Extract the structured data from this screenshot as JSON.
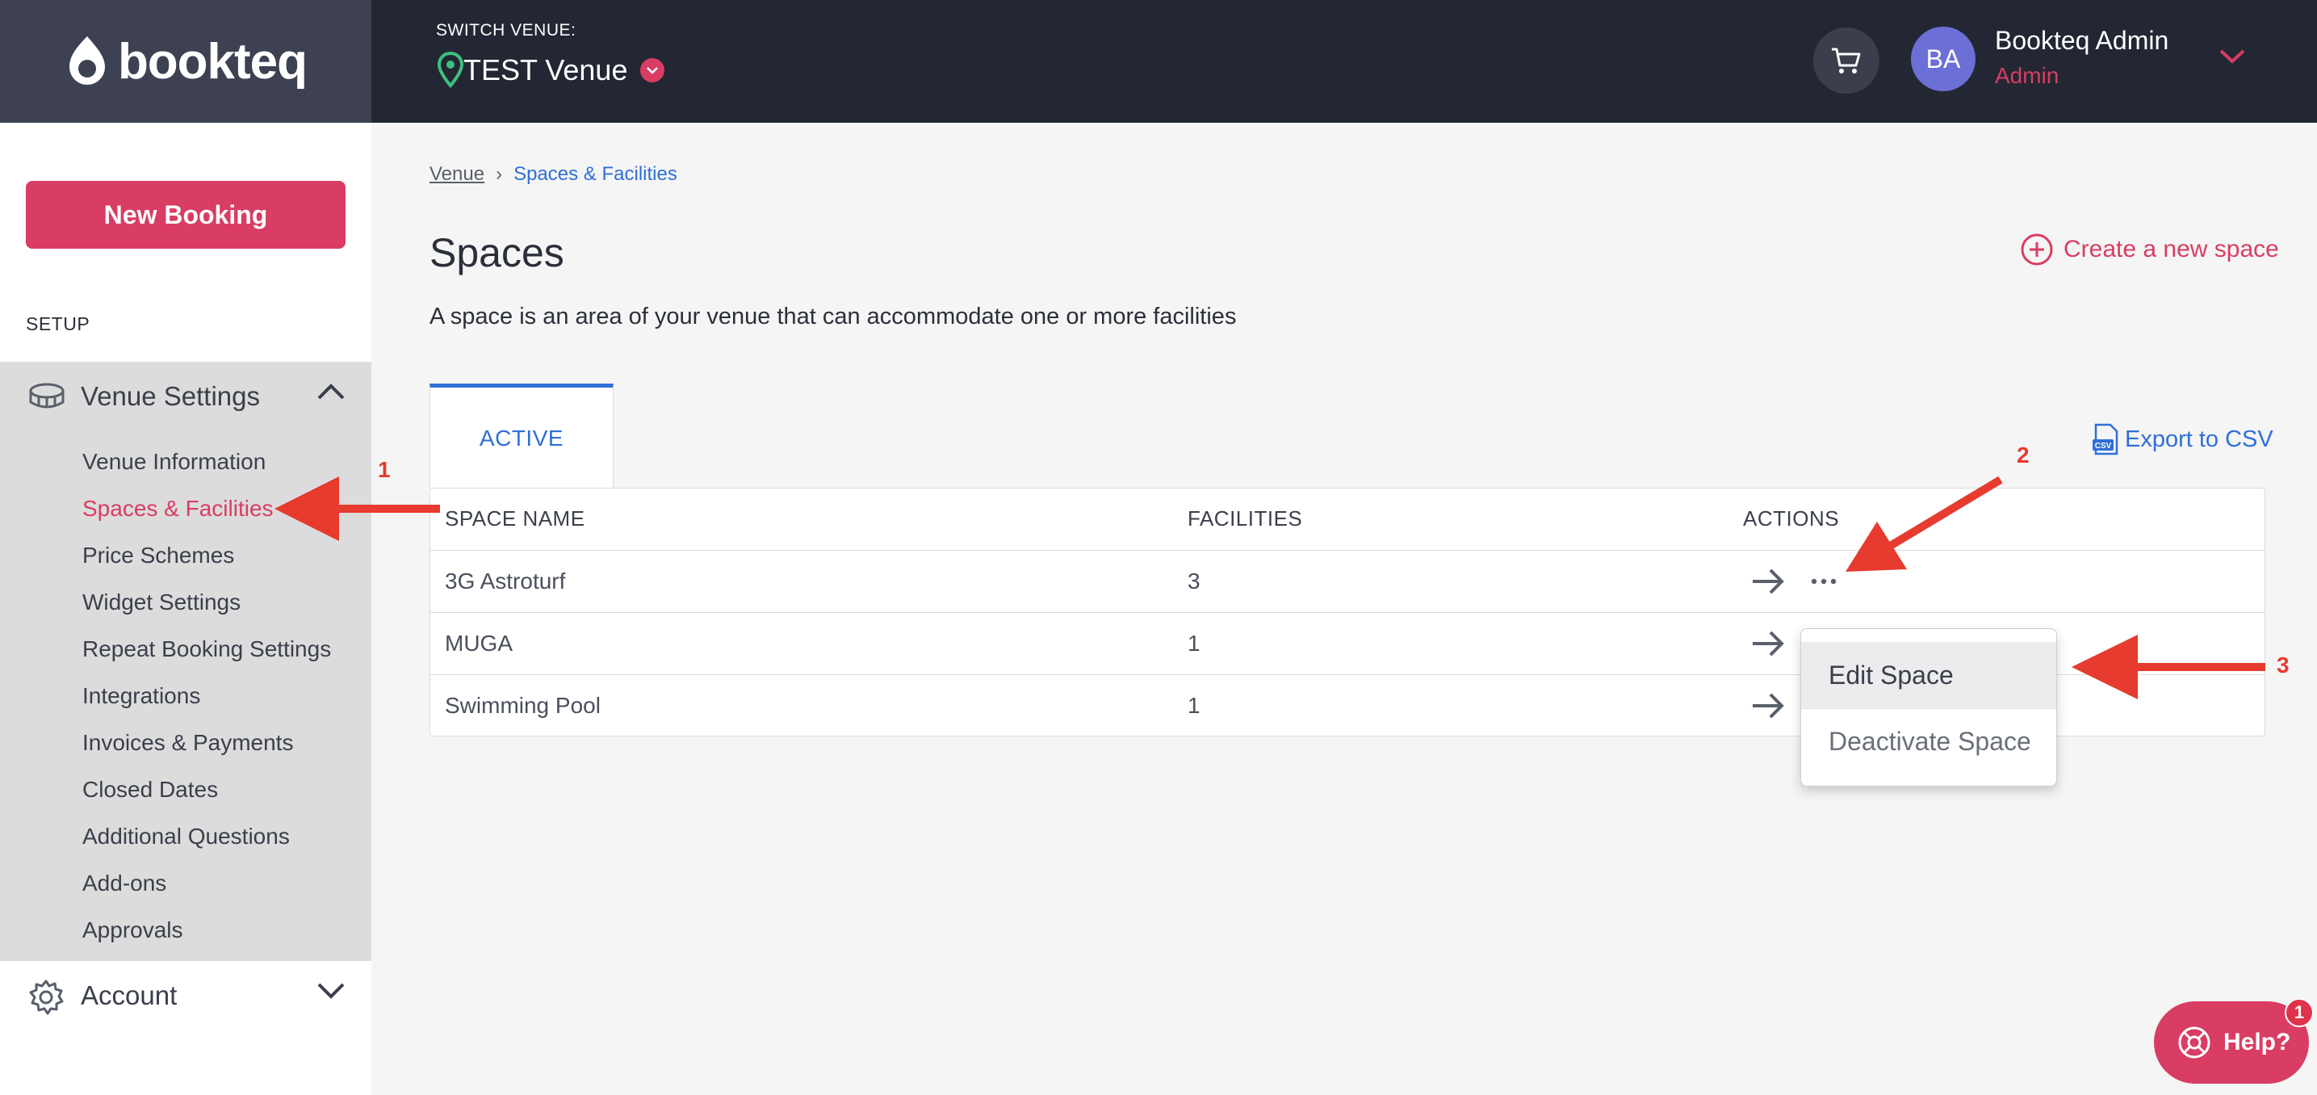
{
  "app": {
    "logo": "bookteq"
  },
  "header": {
    "switch_label": "SWITCH VENUE:",
    "venue_name": "TEST Venue",
    "user_initials": "BA",
    "user_name": "Bookteq Admin",
    "user_role": "Admin"
  },
  "sidebar": {
    "new_booking": "New Booking",
    "setup_label": "SETUP",
    "venue_settings": {
      "title": "Venue Settings",
      "items": [
        {
          "label": "Venue Information",
          "active": false
        },
        {
          "label": "Spaces & Facilities",
          "active": true
        },
        {
          "label": "Price Schemes",
          "active": false
        },
        {
          "label": "Widget Settings",
          "active": false
        },
        {
          "label": "Repeat Booking Settings",
          "active": false
        },
        {
          "label": "Integrations",
          "active": false
        },
        {
          "label": "Invoices & Payments",
          "active": false
        },
        {
          "label": "Closed Dates",
          "active": false
        },
        {
          "label": "Additional Questions",
          "active": false
        },
        {
          "label": "Add-ons",
          "active": false
        },
        {
          "label": "Approvals",
          "active": false
        }
      ]
    },
    "account": "Account"
  },
  "breadcrumb": {
    "parent": "Venue",
    "separator": "›",
    "current": "Spaces & Facilities"
  },
  "page": {
    "title": "Spaces",
    "description": "A space is an area of your venue that can accommodate one or more facilities",
    "create_link": "Create a new space",
    "tab_active": "ACTIVE",
    "export": "Export to CSV"
  },
  "table": {
    "headers": [
      "SPACE NAME",
      "FACILITIES",
      "ACTIONS"
    ],
    "rows": [
      {
        "name": "3G Astroturf",
        "facilities": "3"
      },
      {
        "name": "MUGA",
        "facilities": "1"
      },
      {
        "name": "Swimming Pool",
        "facilities": "1"
      }
    ]
  },
  "dropdown": {
    "items": [
      "Edit Space",
      "Deactivate Space"
    ]
  },
  "annotations": [
    "1",
    "2",
    "3"
  ],
  "help": {
    "label": "Help?",
    "badge": "1"
  },
  "colors": {
    "accent": "#d93d63",
    "link": "#2f6fd8",
    "topbar": "#222733",
    "annotation": "#e63b2e"
  }
}
